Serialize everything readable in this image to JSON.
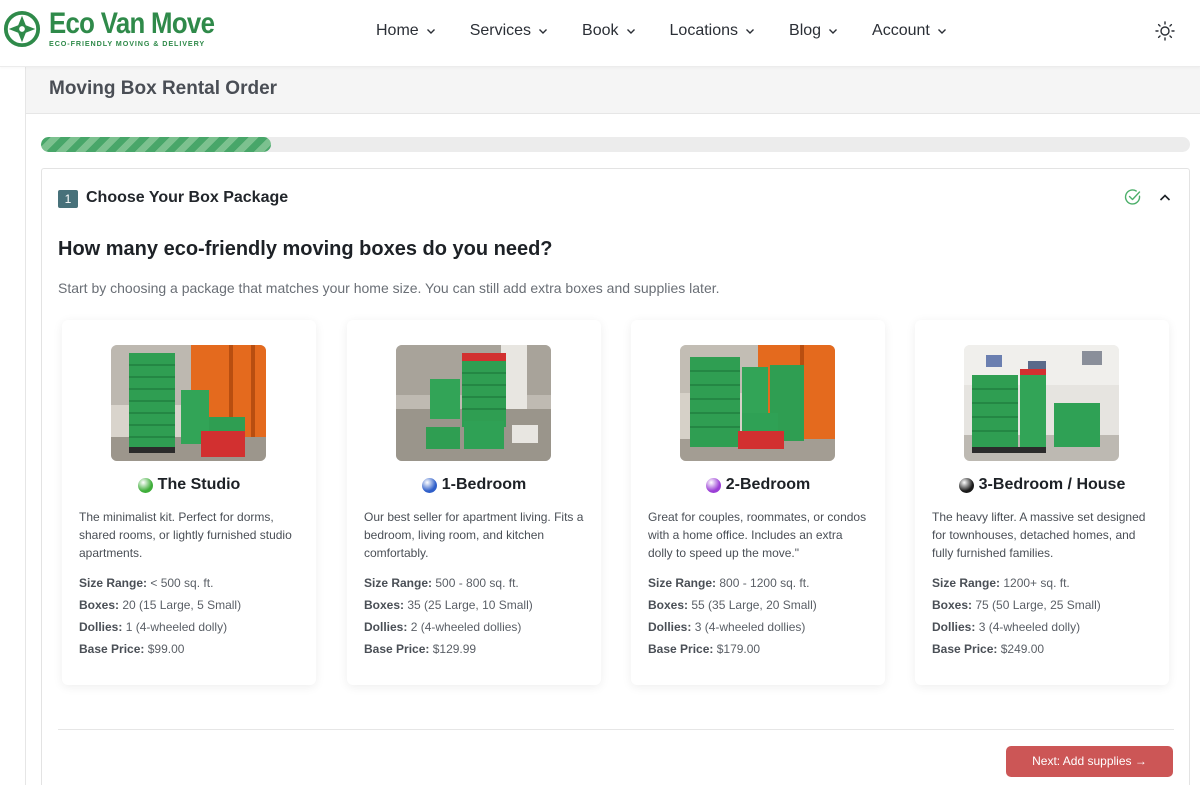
{
  "header": {
    "logo_title": "Eco Van Move",
    "logo_subtitle": "ECO-FRIENDLY MOVING & DELIVERY",
    "nav": [
      {
        "label": "Home"
      },
      {
        "label": "Services"
      },
      {
        "label": "Book"
      },
      {
        "label": "Locations"
      },
      {
        "label": "Blog"
      },
      {
        "label": "Account"
      }
    ],
    "theme_icon": "sun-icon"
  },
  "page": {
    "title": "Moving Box Rental Order",
    "progress_fraction": 0.2
  },
  "step": {
    "number": "1",
    "title": "Choose Your Box Package",
    "status_icon": "check-circle-icon",
    "question": "How many eco-friendly moving boxes do you need?",
    "intro": "Start by choosing a package that matches your home size. You can still add extra boxes and supplies later.",
    "next_button": "Next: Add supplies →"
  },
  "spec_labels": {
    "size": "Size Range:",
    "boxes": "Boxes:",
    "dollies": "Dollies:",
    "price": "Base Price:"
  },
  "packages": [
    {
      "dot_color": "#3fae3a",
      "name": "The Studio",
      "description": "The minimalist kit. Perfect for dorms, shared rooms, or lightly furnished studio apartments.",
      "size": "< 500 sq. ft.",
      "boxes": "20 (15 Large, 5 Small)",
      "dollies": "1 (4-wheeled dolly)",
      "price": "$99.00"
    },
    {
      "dot_color": "#2f5fc9",
      "name": "1-Bedroom",
      "description": "Our best seller for apartment living. Fits a bedroom, living room, and kitchen comfortably.",
      "size": "500 - 800 sq. ft.",
      "boxes": "35 (25 Large, 10 Small)",
      "dollies": "2 (4-wheeled dollies)",
      "price": "$129.99"
    },
    {
      "dot_color": "#9b3fd6",
      "name": "2-Bedroom",
      "description": "Great for couples, roommates, or condos with a home office. Includes an extra dolly to speed up the move.\"",
      "size": "800 - 1200 sq. ft.",
      "boxes": "55 (35 Large, 20 Small)",
      "dollies": "3 (4-wheeled dollies)",
      "price": "$179.00"
    },
    {
      "dot_color": "#1a1a1a",
      "name": "3-Bedroom / House",
      "description": "The heavy lifter. A massive set designed for townhouses, detached homes, and fully furnished families.",
      "size": "1200+ sq. ft.",
      "boxes": "75 (50 Large, 25 Small)",
      "dollies": "3 (4-wheeled dolly)",
      "price": "$249.00"
    }
  ]
}
